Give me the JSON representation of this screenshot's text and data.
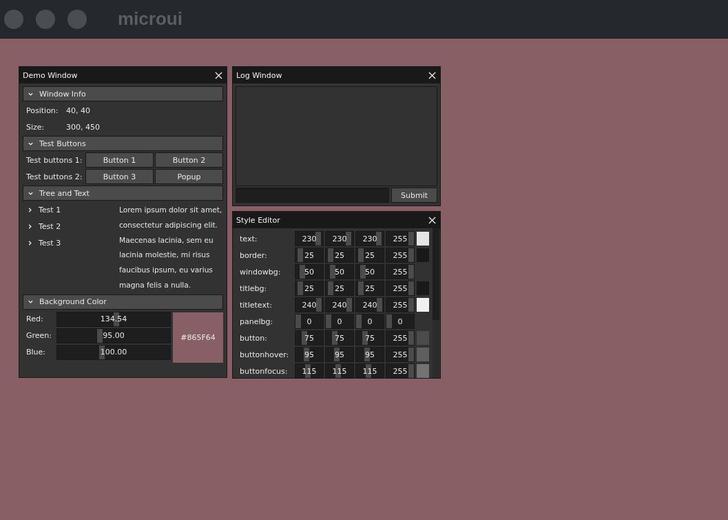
{
  "app_title": "microui",
  "demo_window": {
    "title": "Demo Window",
    "window_info": {
      "header": "Window Info",
      "expanded": true,
      "rows": [
        {
          "label": "Position:",
          "value": "40, 40"
        },
        {
          "label": "Size:",
          "value": "300, 450"
        }
      ]
    },
    "test_buttons": {
      "header": "Test Buttons",
      "expanded": true,
      "rows": [
        {
          "label": "Test buttons 1:",
          "buttons": [
            "Button 1",
            "Button 2"
          ]
        },
        {
          "label": "Test buttons 2:",
          "buttons": [
            "Button 3",
            "Popup"
          ]
        }
      ]
    },
    "tree_and_text": {
      "header": "Tree and Text",
      "expanded": true,
      "tree": [
        {
          "label": "Test 1",
          "expanded": false
        },
        {
          "label": "Test 2",
          "expanded": false
        },
        {
          "label": "Test 3",
          "expanded": false
        }
      ],
      "text": "Lorem ipsum dolor sit amet, consectetur adipiscing elit. Maecenas lacinia, sem eu lacinia molestie, mi risus faucibus ipsum, eu varius magna felis a nulla."
    },
    "background_color": {
      "header": "Background Color",
      "expanded": true,
      "sliders": [
        {
          "label": "Red:",
          "reading": "134.54",
          "level": 0.5276
        },
        {
          "label": "Green:",
          "reading": "95.00",
          "level": 0.3725
        },
        {
          "label": "Blue:",
          "reading": "100.00",
          "level": 0.3922
        }
      ],
      "hex": "#865F64"
    }
  },
  "log_window": {
    "title": "Log Window",
    "button": "Submit"
  },
  "style_editor": {
    "title": "Style Editor",
    "rows": [
      {
        "label": "text:",
        "channels": [
          {
            "reading": "230",
            "level": 0.902
          },
          {
            "reading": "230",
            "level": 0.902
          },
          {
            "reading": "230",
            "level": 0.902
          },
          {
            "reading": "255",
            "level": 1
          }
        ]
      },
      {
        "label": "border:",
        "channels": [
          {
            "reading": "25",
            "level": 0.098
          },
          {
            "reading": "25",
            "level": 0.098
          },
          {
            "reading": "25",
            "level": 0.098
          },
          {
            "reading": "255",
            "level": 1
          }
        ]
      },
      {
        "label": "windowbg:",
        "channels": [
          {
            "reading": "50",
            "level": 0.196
          },
          {
            "reading": "50",
            "level": 0.196
          },
          {
            "reading": "50",
            "level": 0.196
          },
          {
            "reading": "255",
            "level": 1
          }
        ]
      },
      {
        "label": "titlebg:",
        "channels": [
          {
            "reading": "25",
            "level": 0.098
          },
          {
            "reading": "25",
            "level": 0.098
          },
          {
            "reading": "25",
            "level": 0.098
          },
          {
            "reading": "255",
            "level": 1
          }
        ]
      },
      {
        "label": "titletext:",
        "channels": [
          {
            "reading": "240",
            "level": 0.941
          },
          {
            "reading": "240",
            "level": 0.941
          },
          {
            "reading": "240",
            "level": 0.941
          },
          {
            "reading": "255",
            "level": 1
          }
        ]
      },
      {
        "label": "panelbg:",
        "channels": [
          {
            "reading": "0",
            "level": 0
          },
          {
            "reading": "0",
            "level": 0
          },
          {
            "reading": "0",
            "level": 0
          },
          {
            "reading": "0",
            "level": 0
          }
        ]
      },
      {
        "label": "button:",
        "channels": [
          {
            "reading": "75",
            "level": 0.294
          },
          {
            "reading": "75",
            "level": 0.294
          },
          {
            "reading": "75",
            "level": 0.294
          },
          {
            "reading": "255",
            "level": 1
          }
        ]
      },
      {
        "label": "buttonhover:",
        "channels": [
          {
            "reading": "95",
            "level": 0.3725
          },
          {
            "reading": "95",
            "level": 0.3725
          },
          {
            "reading": "95",
            "level": 0.3725
          },
          {
            "reading": "255",
            "level": 1
          }
        ]
      },
      {
        "label": "buttonfocus:",
        "channels": [
          {
            "reading": "115",
            "level": 0.451
          },
          {
            "reading": "115",
            "level": 0.451
          },
          {
            "reading": "115",
            "level": 0.451
          },
          {
            "reading": "255",
            "level": 1
          }
        ]
      }
    ]
  }
}
